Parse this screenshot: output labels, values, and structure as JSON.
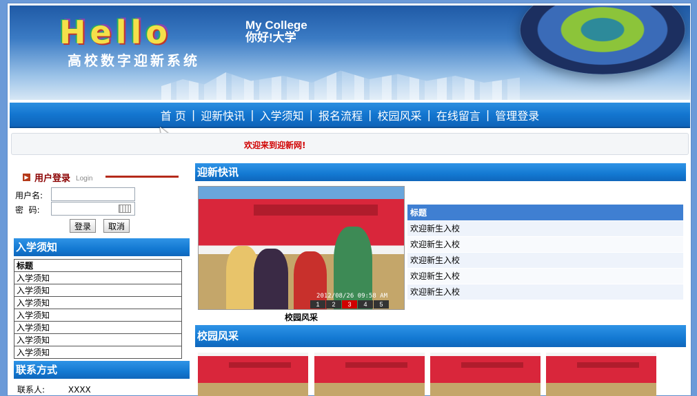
{
  "banner": {
    "hello": "Hello",
    "brand_en": "My College",
    "brand_cn": "你好!大学",
    "subtitle": "高校数字迎新系统"
  },
  "nav": {
    "items": [
      "首 页",
      "迎新快讯",
      "入学须知",
      "报名流程",
      "校园风采",
      "在线留言",
      "管理登录"
    ]
  },
  "welcome": "欢迎来到迎新网!",
  "login": {
    "title": "用户登录",
    "subtitle": "Login",
    "username_label": "用户名:",
    "password_label": "密  码:",
    "username_value": "",
    "password_value": "",
    "login_button": "登录",
    "cancel_button": "取消"
  },
  "notice": {
    "heading": "入学须知",
    "col_header": "标题",
    "rows": [
      "入学须知",
      "入学须知",
      "入学须知",
      "入学须知",
      "入学须知",
      "入学须知",
      "入学须知"
    ]
  },
  "contact": {
    "heading": "联系方式",
    "person_label": "联系人:",
    "person_value": "XXXX"
  },
  "news": {
    "heading": "迎新快讯",
    "col_header": "标题",
    "rows": [
      "欢迎新生入校",
      "欢迎新生入校",
      "欢迎新生入校",
      "欢迎新生入校",
      "欢迎新生入校"
    ],
    "photo_caption": "校园风采",
    "photo_timestamp": "2012/08/26 09:58 AM",
    "pager": [
      "1",
      "2",
      "3",
      "4",
      "5"
    ],
    "pager_active": "3"
  },
  "campus": {
    "heading": "校园风采"
  },
  "colors": {
    "nav_blue": "#1375cf",
    "welcome_red": "#d00000",
    "login_red": "#8b0000",
    "table_head": "#3f7fd2"
  }
}
